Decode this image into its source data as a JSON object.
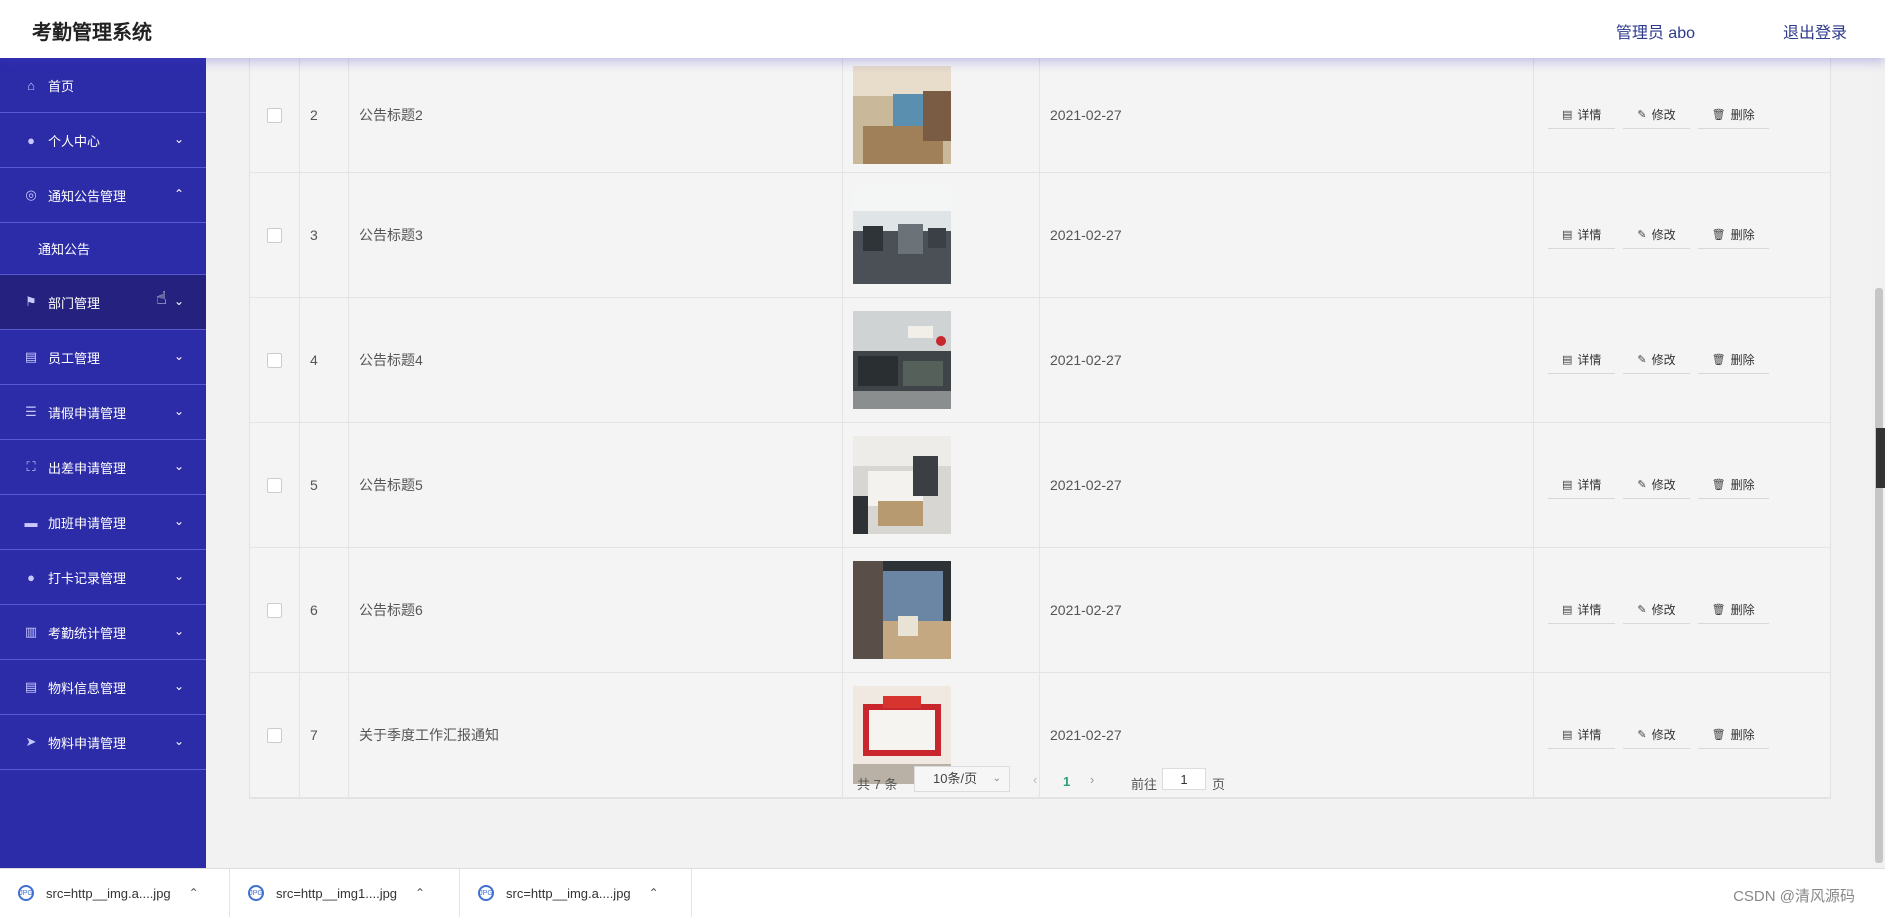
{
  "header": {
    "title": "考勤管理系统",
    "user": "管理员 abo",
    "logout": "退出登录"
  },
  "sidebar": {
    "items": [
      {
        "label": "首页",
        "icon": "home-icon"
      },
      {
        "label": "个人中心",
        "icon": "user-icon"
      },
      {
        "label": "通知公告管理",
        "icon": "notice-icon"
      },
      {
        "label": "部门管理",
        "icon": "flag-icon"
      },
      {
        "label": "员工管理",
        "icon": "clipboard-icon"
      },
      {
        "label": "请假申请管理",
        "icon": "menu-icon"
      },
      {
        "label": "出差申请管理",
        "icon": "fullscreen-icon"
      },
      {
        "label": "加班申请管理",
        "icon": "monitor-icon"
      },
      {
        "label": "打卡记录管理",
        "icon": "user-icon"
      },
      {
        "label": "考勤统计管理",
        "icon": "data-icon"
      },
      {
        "label": "物料信息管理",
        "icon": "clipboard-icon"
      },
      {
        "label": "物料申请管理",
        "icon": "send-icon"
      }
    ],
    "sub_item": "通知公告",
    "active_item": "部门管理"
  },
  "table": {
    "rows": [
      {
        "index": "2",
        "title": "公告标题2",
        "date": "2021-02-27"
      },
      {
        "index": "3",
        "title": "公告标题3",
        "date": "2021-02-27"
      },
      {
        "index": "4",
        "title": "公告标题4",
        "date": "2021-02-27"
      },
      {
        "index": "5",
        "title": "公告标题5",
        "date": "2021-02-27"
      },
      {
        "index": "6",
        "title": "公告标题6",
        "date": "2021-02-27"
      },
      {
        "index": "7",
        "title": "关于季度工作汇报通知",
        "date": "2021-02-27"
      }
    ],
    "actions": {
      "detail": "详情",
      "edit": "修改",
      "delete": "删除"
    }
  },
  "pagination": {
    "total": "共 7 条",
    "page_size": "10条/页",
    "current": "1",
    "goto_prefix": "前往",
    "goto_value": "1",
    "goto_suffix": "页"
  },
  "downloads": [
    {
      "name": "src=http__img.a....jpg"
    },
    {
      "name": "src=http__img1....jpg"
    },
    {
      "name": "src=http__img.a....jpg"
    }
  ],
  "watermark": "CSDN @清风源码",
  "colors": {
    "sidebar": "#2c2ba8",
    "sidebar_active": "#24227e",
    "accent": "#2d3a8c",
    "page_current": "#2aa27a"
  }
}
